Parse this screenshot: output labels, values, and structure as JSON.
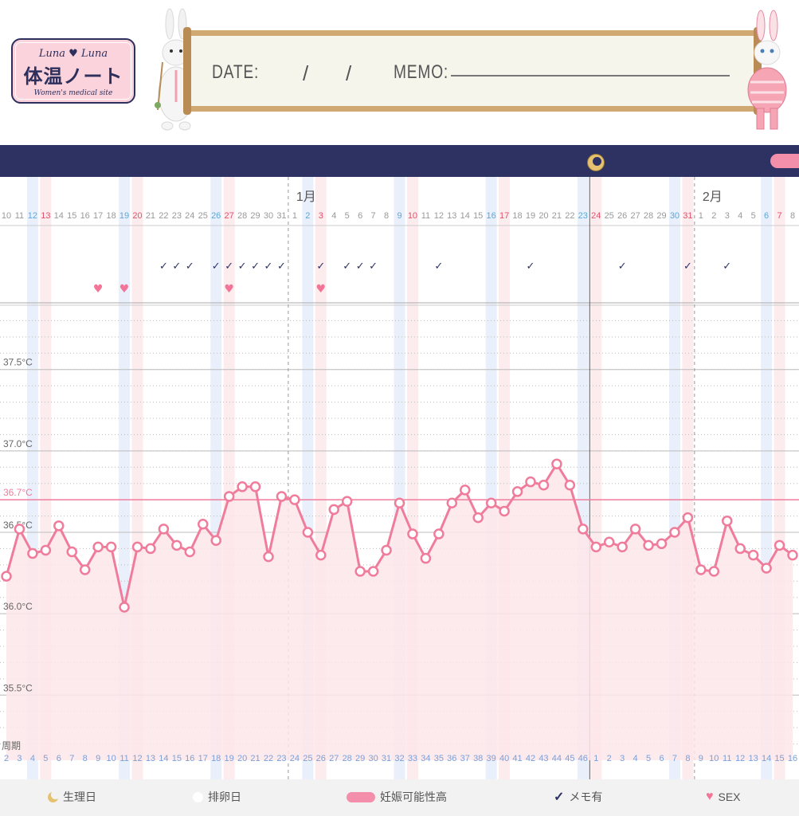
{
  "header": {
    "logo": {
      "brand": "Luna ♥ Luna",
      "title": "体温ノート",
      "subtitle": "Women's medical site"
    },
    "date_label": "DATE:",
    "slash": "/",
    "memo_label": "MEMO:"
  },
  "legend": {
    "period": "生理日",
    "ovulation": "排卵日",
    "fertile": "妊娠可能性高",
    "memo": "メモ有",
    "sex": "SEX"
  },
  "colors": {
    "navy": "#2d3263",
    "pink": "#f48fab",
    "line": "#f07c9c",
    "fill": "#fde6ea",
    "sat_blue": "#5aa7dc",
    "sun_red": "#e0506b"
  },
  "chart_data": {
    "type": "line",
    "ylim": [
      35.1,
      37.9
    ],
    "y_ticks": [
      "37.5°C",
      "37.0°C",
      "36.7°C",
      "36.5°C",
      "36.0°C",
      "35.5°C"
    ],
    "reference_temp": 36.7,
    "month_labels": [
      "1月",
      "2月"
    ],
    "cycle_label": "周期",
    "days": [
      "10",
      "11",
      "12",
      "13",
      "14",
      "15",
      "16",
      "17",
      "18",
      "19",
      "20",
      "21",
      "22",
      "23",
      "24",
      "25",
      "26",
      "27",
      "28",
      "29",
      "30",
      "31",
      "1",
      "2",
      "3",
      "4",
      "5",
      "6",
      "7",
      "8",
      "9",
      "10",
      "11",
      "12",
      "13",
      "14",
      "15",
      "16",
      "17",
      "18",
      "19",
      "20",
      "21",
      "22",
      "23",
      "24",
      "25",
      "26",
      "27",
      "28",
      "29",
      "30",
      "31",
      "1",
      "2",
      "3",
      "4",
      "5",
      "6",
      "7",
      "8"
    ],
    "cycle_days": [
      "2",
      "3",
      "4",
      "5",
      "6",
      "7",
      "8",
      "9",
      "10",
      "11",
      "12",
      "13",
      "14",
      "15",
      "16",
      "17",
      "18",
      "19",
      "20",
      "21",
      "22",
      "23",
      "24",
      "25",
      "26",
      "27",
      "28",
      "29",
      "30",
      "31",
      "32",
      "33",
      "34",
      "35",
      "36",
      "37",
      "38",
      "39",
      "40",
      "41",
      "42",
      "43",
      "44",
      "45",
      "46",
      "1",
      "2",
      "3",
      "4",
      "5",
      "6",
      "7",
      "8",
      "9",
      "10",
      "11",
      "12",
      "13",
      "14",
      "15",
      "16"
    ],
    "temps": [
      36.23,
      36.52,
      36.37,
      36.39,
      36.54,
      36.38,
      36.27,
      36.41,
      36.41,
      36.04,
      36.41,
      36.4,
      36.52,
      36.42,
      36.38,
      36.55,
      36.45,
      36.72,
      36.78,
      36.78,
      36.35,
      36.72,
      36.7,
      36.5,
      36.36,
      36.64,
      36.69,
      36.26,
      36.26,
      36.39,
      36.68,
      36.49,
      36.34,
      36.49,
      36.68,
      36.76,
      36.59,
      36.68,
      36.63,
      36.75,
      36.81,
      36.79,
      36.92,
      36.79,
      36.52,
      36.41,
      36.44,
      36.41,
      36.52,
      36.42,
      36.43,
      36.5,
      36.59,
      36.27,
      36.26,
      36.57,
      36.4,
      36.36,
      36.28,
      36.42,
      36.36
    ],
    "memo_days": [
      12,
      13,
      14,
      16,
      17,
      18,
      19,
      20,
      21,
      24,
      26,
      27,
      28,
      33,
      40,
      47,
      52,
      55
    ],
    "sex_days": [
      7,
      9,
      17,
      24
    ],
    "weekend_sat": [
      2,
      9,
      16,
      23,
      30,
      37,
      44,
      51,
      58
    ],
    "weekend_sun": [
      3,
      10,
      17,
      24,
      31,
      38,
      45,
      52,
      59
    ],
    "month_starts": [
      22,
      53
    ],
    "current_day": 45
  }
}
